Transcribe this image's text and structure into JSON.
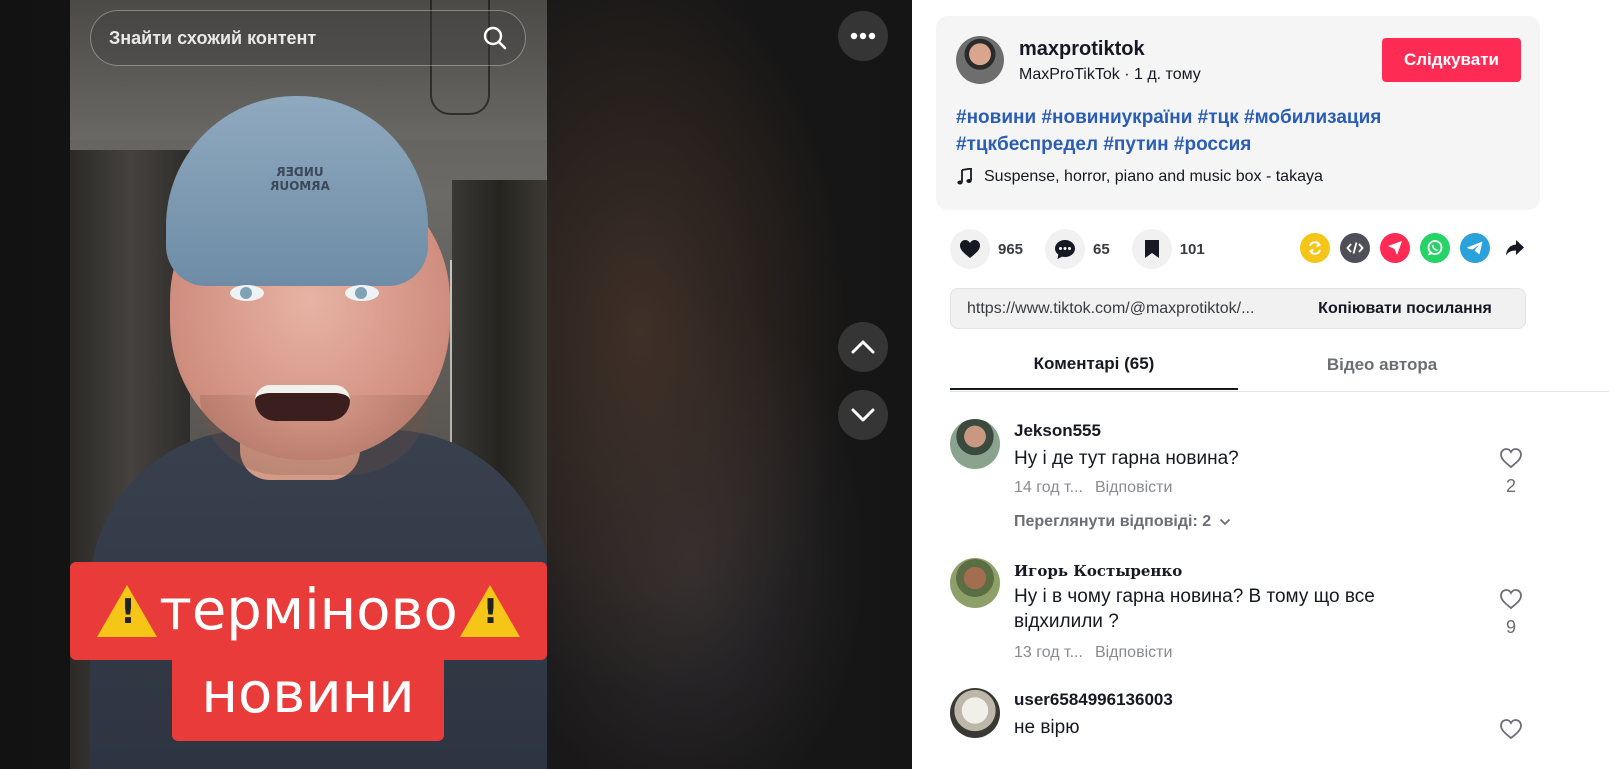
{
  "video": {
    "search_placeholder": "Знайти схожий контент",
    "caption_line1": "терміново",
    "caption_line2": "новини",
    "cap_logo_text": "UNDER ARMOUR"
  },
  "author": {
    "username": "maxprotiktok",
    "display_name": "MaxProTikTok",
    "separator": " · ",
    "posted": "1 д. тому",
    "follow_label": "Слідкувати",
    "hashtags": [
      "#новини",
      "#новиниукраїни",
      "#тцк",
      "#мобилизация",
      "#тцкбеспредел",
      "#путин",
      "#россия"
    ],
    "music": "Suspense, horror, piano and music box - takaya"
  },
  "actions": {
    "likes": "965",
    "comments": "65",
    "saves": "101"
  },
  "share_colors": {
    "repost": "#f5c518",
    "embed": "#4f5057",
    "direct": "#fe2c55",
    "whatsapp": "#25d366",
    "telegram": "#2aa1da"
  },
  "link": {
    "url": "https://www.tiktok.com/@maxprotiktok/...",
    "copy_label": "Копіювати посилання"
  },
  "tabs": {
    "comments": "Коментарі (65)",
    "author_videos": "Відео автора"
  },
  "comments": [
    {
      "user": "Jekson555",
      "text": "Ну і де тут гарна новина?",
      "time": "14 год т...",
      "reply": "Відповісти",
      "likes": "2",
      "view_replies": "Переглянути відповіді: 2"
    },
    {
      "user": "Игорь Костыренко",
      "text": "Ну і в чому гарна новина? В тому що все відхилили ?",
      "time": "13 год т...",
      "reply": "Відповісти",
      "likes": "9"
    },
    {
      "user": "user6584996136003",
      "text": "не вірю"
    }
  ]
}
